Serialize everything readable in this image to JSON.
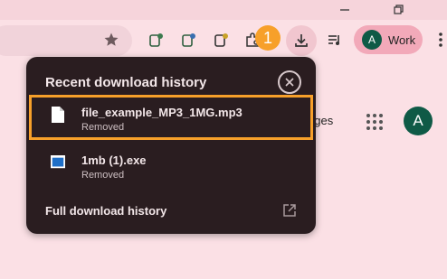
{
  "toolbar": {
    "badge_number": "1",
    "profile_initial": "A",
    "profile_label": "Work",
    "icons": [
      "bookmark-star-icon",
      "extension-icon",
      "extension-icon",
      "extension-icon",
      "extensions-puzzle-icon",
      "download-icon",
      "media-control-icon",
      "more-menu-icon"
    ]
  },
  "page": {
    "partial_text": "ages",
    "avatar_initial": "A"
  },
  "popup": {
    "title": "Recent download history",
    "items": [
      {
        "name": "file_example_MP3_1MG.mp3",
        "status": "Removed",
        "icon": "file-icon"
      },
      {
        "name": "1mb (1).exe",
        "status": "Removed",
        "icon": "exe-file-icon"
      }
    ],
    "footer_link": "Full download history"
  },
  "colors": {
    "background": "#fbe0e5",
    "popup_bg": "#2a1d20",
    "highlight": "#f7a02a",
    "avatar": "#0f5a46"
  }
}
